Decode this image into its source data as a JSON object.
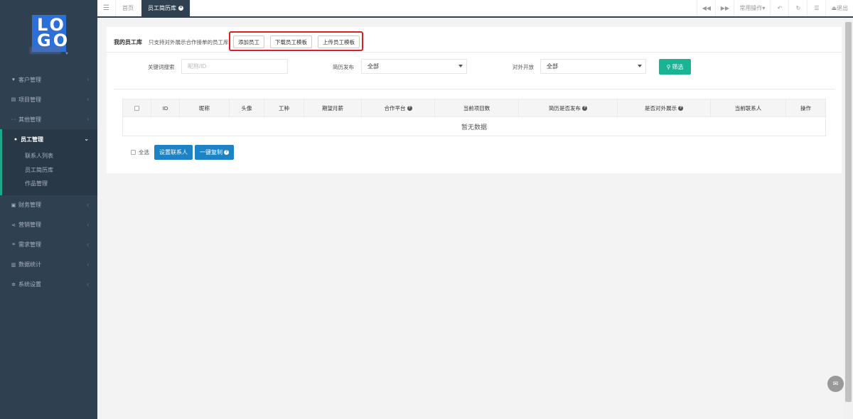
{
  "logo": {
    "text_line1": "LO",
    "text_line2": "GO"
  },
  "sidebar": {
    "items": [
      {
        "label": "客户管理",
        "icon": "heart-icon",
        "glyph": "♥"
      },
      {
        "label": "项目管理",
        "icon": "briefcase-icon",
        "glyph": "▤"
      },
      {
        "label": "其他管理",
        "icon": "ellipsis-icon",
        "glyph": "···"
      },
      {
        "label": "员工管理",
        "icon": "users-icon",
        "glyph": "👥",
        "active": true,
        "children": [
          "联系人列表",
          "员工简历库",
          "作品管理"
        ]
      },
      {
        "label": "财务管理",
        "icon": "money-icon",
        "glyph": "▣"
      },
      {
        "label": "营销管理",
        "icon": "share-icon",
        "glyph": "⋖"
      },
      {
        "label": "需求管理",
        "icon": "list-icon",
        "glyph": "≡"
      },
      {
        "label": "数据统计",
        "icon": "bar-chart-icon",
        "glyph": "▥"
      },
      {
        "label": "系统设置",
        "icon": "gear-icon",
        "glyph": "✲"
      }
    ]
  },
  "topbar": {
    "tabs": [
      {
        "label": "首页"
      },
      {
        "label": "员工简历库",
        "active": true
      }
    ],
    "right": {
      "backward": "◀◀",
      "forward": "▶▶",
      "common_ops": "常用操作▾",
      "undo": "↶",
      "refresh": "↻",
      "fullscreen": "☰",
      "logout": "⏏退出"
    }
  },
  "toolbar": {
    "title": "我的员工库",
    "note": "只支持对外展示合作接单的员工库",
    "add_label": "添加员工",
    "download_label": "下载员工模板",
    "upload_label": "上传员工模板"
  },
  "filters": {
    "keyword_label": "关键词搜索",
    "keyword_placeholder": "昵称/ID",
    "resume_label": "简历发布",
    "resume_value": "全部",
    "open_label": "对外开放",
    "open_value": "全部",
    "search_label": "筛选"
  },
  "table": {
    "headers": [
      "ID",
      "昵称",
      "头像",
      "工种",
      "期望月薪",
      "合作平台",
      "当前项目数",
      "简历是否发布",
      "是否对外展示",
      "当前联系人",
      "操作"
    ],
    "empty_text": "暂无数据"
  },
  "bottom": {
    "select_all": "全选",
    "set_contact": "设置联系人",
    "copy_all": "一键复制"
  },
  "colors": {
    "sidebar_bg": "#2f4050",
    "accent_green": "#1ab394",
    "accent_blue": "#1c84c6",
    "highlight_red": "#e02020"
  }
}
